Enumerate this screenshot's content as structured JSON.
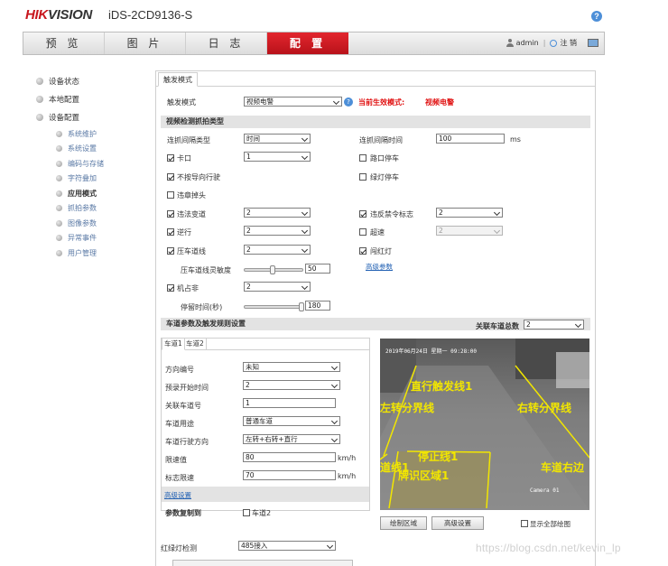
{
  "brand": {
    "hik": "HIK",
    "vision": "VISION"
  },
  "device_model": "iDS-2CD9136-S",
  "help_glyph": "?",
  "nav": {
    "tabs": [
      "预 览",
      "图 片",
      "日 志",
      "配 置"
    ],
    "username": "admin",
    "separator": "|",
    "logout": "注 销"
  },
  "sidebar": {
    "groups": [
      "设备状态",
      "本地配置",
      "设备配置"
    ],
    "items": [
      "系统维护",
      "系统设置",
      "编码与存储",
      "字符叠加",
      "应用模式",
      "抓拍参数",
      "图像参数",
      "异常事件",
      "用户管理"
    ]
  },
  "main_tab": "触发模式",
  "trigger": {
    "label": "触发模式",
    "value": "视频电警",
    "status_label": "当前生效模式:",
    "status_value": "视频电警"
  },
  "video_detect": {
    "header": "视频检测抓拍类型",
    "interval_type_label": "连抓间隔类型",
    "interval_type_value": "时间",
    "interval_time_label": "连抓间隔时间",
    "interval_time_value": "100",
    "interval_unit": "ms",
    "left": [
      {
        "label": "卡口",
        "value": "1"
      },
      {
        "label": "不按导向行驶"
      },
      {
        "label": "违章掉头"
      },
      {
        "label": "违法变道",
        "value": "2"
      },
      {
        "label": "逆行",
        "value": "2"
      },
      {
        "label": "压车道线",
        "value": "2"
      }
    ],
    "right": [
      {
        "label": "路口停车"
      },
      {
        "label": "绿灯停车"
      },
      {
        "label": "违反禁令标志",
        "value": "2"
      },
      {
        "label": "超速",
        "value": "2"
      },
      {
        "label": "闯红灯"
      }
    ],
    "sensitivity_label": "压车道线灵敏度",
    "sensitivity_value": "50",
    "advanced_link": "高级参数",
    "occupy_label": "机占非",
    "occupy_value": "2",
    "stay_label": "停留时间(秒)",
    "stay_value": "180"
  },
  "lane": {
    "header": "车道参数及触发规则设置",
    "total_label": "关联车道总数",
    "total_value": "2",
    "tabs": [
      "车道1",
      "车道2"
    ],
    "direction_label": "方向编号",
    "direction_value": "未知",
    "record_label": "预录开始时间",
    "record_value": "2",
    "assoc_label": "关联车道号",
    "assoc_value": "1",
    "usage_label": "车道用途",
    "usage_value": "普通车道",
    "drive_dir_label": "车道行驶方向",
    "drive_dir_value": "左转+右转+直行",
    "speed_limit_label": "限速值",
    "speed_limit_value": "80",
    "sign_speed_label": "标志限速",
    "sign_speed_value": "70",
    "speed_unit": "km/h",
    "advanced_link": "高级设置",
    "copy_label": "参数复制到",
    "copy_target": "车道2"
  },
  "camera": {
    "osd_date": "2019年06月24日 星期一 09:28:00",
    "osd_name": "Camera 01",
    "overlays": [
      "直行触发线1",
      "左转分界线",
      "右转分界线",
      "停止线1",
      "道线1",
      "车道右边",
      "牌识区域1"
    ]
  },
  "buttons": {
    "draw_area": "绘制区域",
    "advanced": "高级设置",
    "show_all": "显示全部绘图"
  },
  "red_light": {
    "label": "红绿灯检测",
    "value": "485接入"
  },
  "watermark": "https://blog.csdn.net/kevin_lp",
  "colors": {
    "brand_red": "#c8161d",
    "active_tab": "#d41e26",
    "link": "#2563b4",
    "overlay_line": "#f2e600"
  }
}
